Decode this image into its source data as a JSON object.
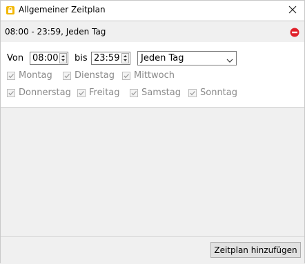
{
  "window": {
    "title": "Allgemeiner Zeitplan"
  },
  "header": {
    "summary": "08:00 - 23:59, Jeden Tag"
  },
  "schedule": {
    "from_label": "Von",
    "from_value": "08:00",
    "to_label": "bis",
    "to_value": "23:59",
    "recurrence": "Jeden Tag",
    "days": [
      {
        "label": "Montag",
        "checked": true
      },
      {
        "label": "Dienstag",
        "checked": true
      },
      {
        "label": "Mittwoch",
        "checked": true
      },
      {
        "label": "Donnerstag",
        "checked": true
      },
      {
        "label": "Freitag",
        "checked": true
      },
      {
        "label": "Samstag",
        "checked": true
      },
      {
        "label": "Sonntag",
        "checked": true
      }
    ]
  },
  "footer": {
    "add_label": "Zeitplan hinzufügen"
  },
  "colors": {
    "remove_icon": "#e0202a",
    "disabled_text": "#8a8a8a"
  },
  "icons": {
    "app": "lock-app-icon",
    "close": "close-icon",
    "remove": "remove-icon"
  }
}
